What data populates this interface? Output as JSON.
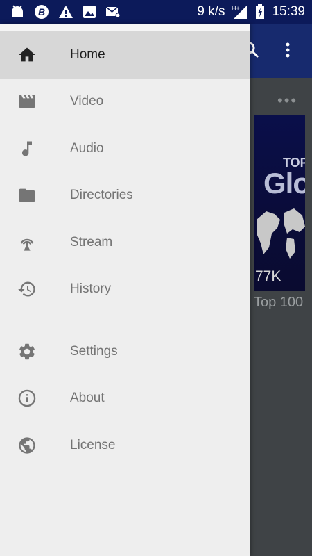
{
  "status_bar": {
    "speed": "9 k/s",
    "network": "H+",
    "time": "15:39"
  },
  "background_app": {
    "thumbnail_text_top": "TOP",
    "thumbnail_text_main": "Glo",
    "thumbnail_count": "77K",
    "item_title": "Top 100",
    "more_label": "•••"
  },
  "drawer": {
    "main_items": [
      {
        "label": "Home",
        "icon": "home-icon",
        "active": true
      },
      {
        "label": "Video",
        "icon": "video-icon"
      },
      {
        "label": "Audio",
        "icon": "music-note-icon"
      },
      {
        "label": "Directories",
        "icon": "folder-icon"
      },
      {
        "label": "Stream",
        "icon": "stream-antenna-icon"
      },
      {
        "label": "History",
        "icon": "history-icon"
      }
    ],
    "secondary_items": [
      {
        "label": "Settings",
        "icon": "gear-icon"
      },
      {
        "label": "About",
        "icon": "info-icon"
      },
      {
        "label": "License",
        "icon": "globe-icon"
      }
    ]
  },
  "colors": {
    "status_bar": "#0c1a5a",
    "toolbar": "#172a6e",
    "drawer_bg": "#eeeeee",
    "active_item_bg": "#d7d7d7"
  }
}
